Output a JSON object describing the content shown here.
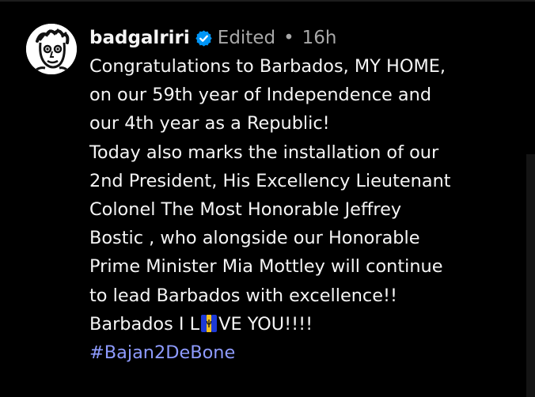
{
  "post": {
    "username": "badgalriri",
    "edited_label": "Edited",
    "separator": "•",
    "timestamp": "16h",
    "caption_lines": [
      "Congratulations to Barbados, MY HOME,",
      "on our 59th year of Independence and",
      "our 4th year as a Republic!",
      "Today also marks the installation of our",
      "2nd President, His Excellency Lieutenant",
      "Colonel The Most Honorable Jeffrey",
      "Bostic , who alongside our Honorable",
      "Prime Minister Mia Mottley will continue",
      "to lead Barbados with excellence!!"
    ],
    "love_line": {
      "before": "Barbados I  L",
      "after": "VE  YOU!!!!"
    },
    "hashtag": "#Bajan2DeBone"
  },
  "icons": {
    "verified": "verified-badge-icon",
    "flag": "barbados-flag-icon",
    "avatar": "profile-avatar"
  },
  "colors": {
    "background": "#000000",
    "text": "#f5f5f5",
    "meta": "#a8a8a8",
    "hashtag": "#8e9bff",
    "verified": "#0095f6",
    "flag_blue": "#1d3ad6",
    "flag_gold": "#f6c21a"
  }
}
